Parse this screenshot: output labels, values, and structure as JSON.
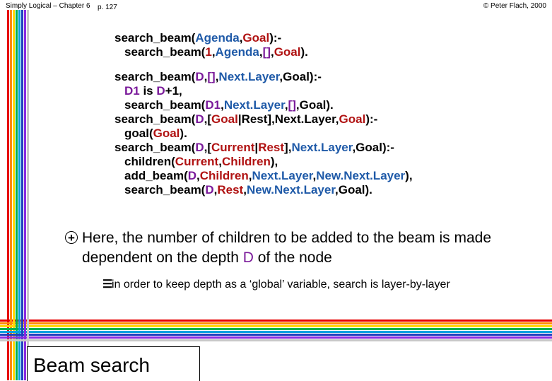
{
  "header": {
    "left": "Simply Logical – Chapter 6",
    "page": "p. 127",
    "right": "© Peter Flach, 2000"
  },
  "code": {
    "l1": [
      "search_beam(",
      "Agenda",
      ",",
      "Goal",
      "):-"
    ],
    "l2": [
      "search_beam(",
      "1",
      ",",
      "Agenda",
      ",",
      "[]",
      ",",
      "Goal",
      ")."
    ],
    "l3": [
      "search_beam(",
      "D",
      ",",
      "[]",
      ",",
      "Next.Layer",
      ",Goal):-"
    ],
    "l4": [
      "D1",
      " is ",
      "D",
      "+1,"
    ],
    "l5": [
      "search_beam(",
      "D1",
      ",",
      "Next.Layer",
      ",",
      "[]",
      ",Goal)."
    ],
    "l6": [
      "search_beam(",
      "D",
      ",[",
      "Goal",
      "|Rest],Next.Layer,",
      "Goal",
      "):-"
    ],
    "l7": [
      "goal(",
      "Goal",
      ")."
    ],
    "l8": [
      "search_beam(",
      "D",
      ",[",
      "Current",
      "|",
      "Rest",
      "],",
      "Next.Layer",
      ",Goal):-"
    ],
    "l9": [
      "children(",
      "Current",
      ",",
      "Children",
      "),"
    ],
    "l10": [
      "add_beam(",
      "D",
      ",",
      "Children",
      ",",
      "Next.Layer",
      ",",
      "New.Next.Layer",
      "),"
    ],
    "l11": [
      "search_beam(",
      "D",
      ",",
      "Rest",
      ",",
      "New.Next.Layer",
      ",Goal)."
    ]
  },
  "bullet1": {
    "icon": "plus-circle-icon",
    "before": "Here, the number of children to be added to the beam is made dependent on the depth ",
    "var": "D",
    "after": " of the node"
  },
  "bullet2": {
    "icon": "numbered-list-icon",
    "text": "in order to keep depth as a ‘global’ variable, search is layer-by-layer"
  },
  "footer": {
    "title": "Beam search"
  },
  "colors": {
    "stripes": [
      "#e60000",
      "#ff8c00",
      "#ffd700",
      "#00b050",
      "#00a0e0",
      "#1f3fbf",
      "#8a2be2",
      "#c8c8c8"
    ],
    "var_blue": "#1f5aa8",
    "var_red": "#b01212",
    "var_purple": "#7a1a9a"
  }
}
